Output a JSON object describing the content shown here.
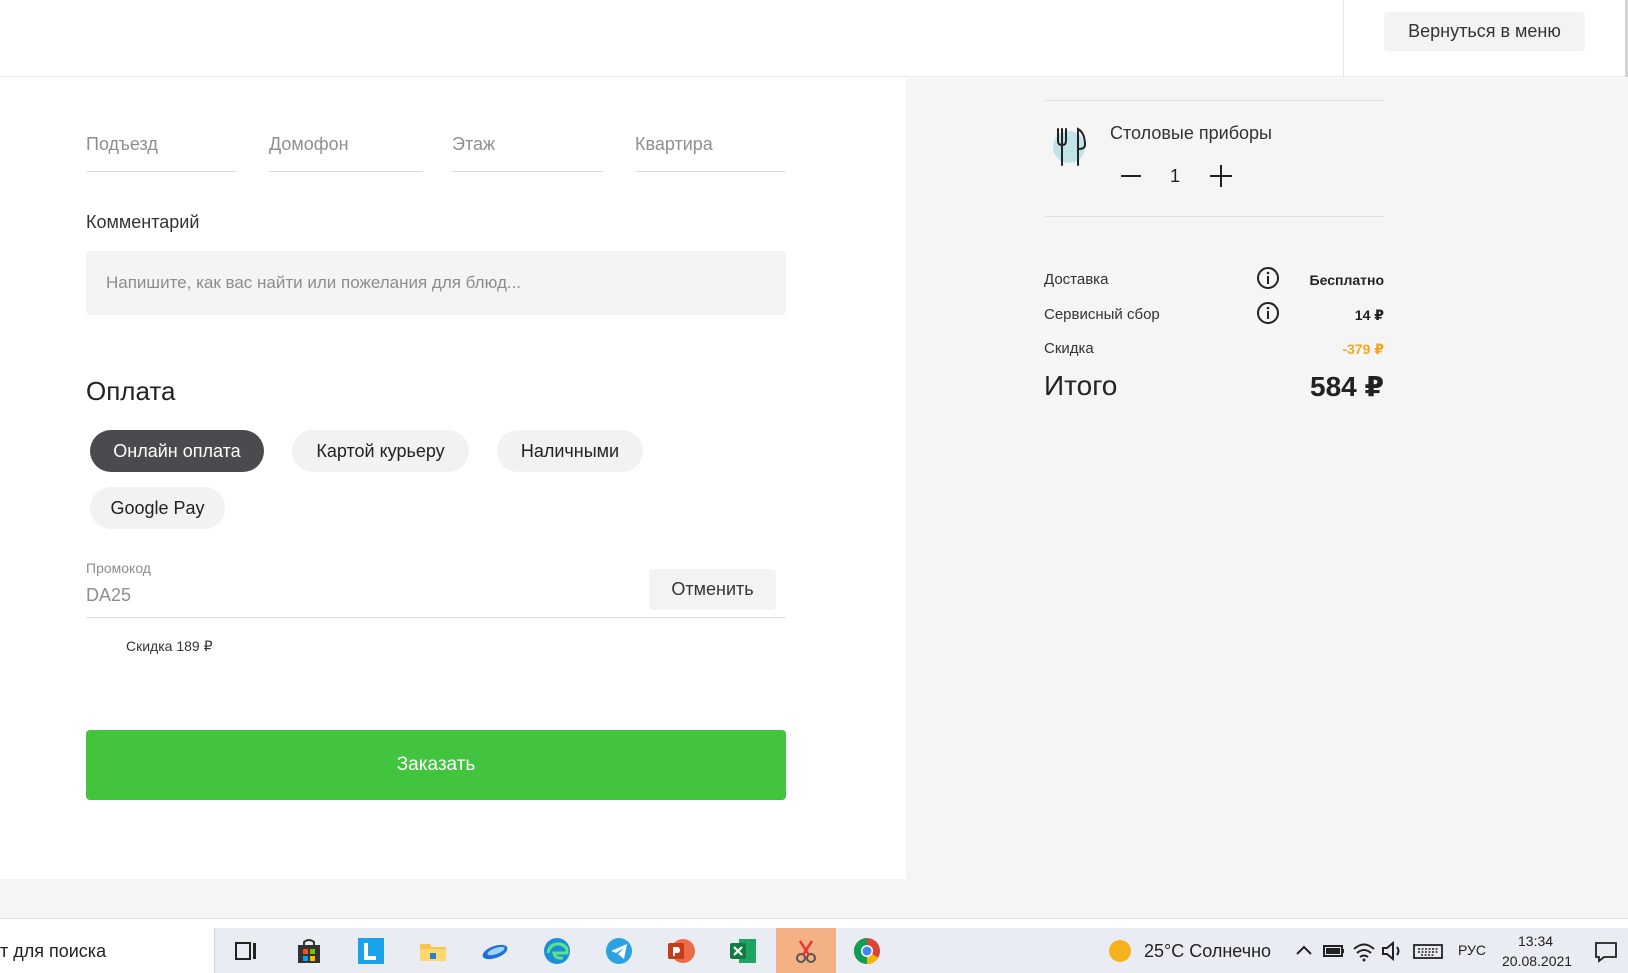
{
  "header": {
    "back_label": "Вернуться в меню"
  },
  "address": {
    "entrance_placeholder": "Подъезд",
    "intercom_placeholder": "Домофон",
    "floor_placeholder": "Этаж",
    "apartment_placeholder": "Квартира"
  },
  "comment": {
    "label": "Комментарий",
    "placeholder": "Напишите, как вас найти или пожелания для блюд..."
  },
  "payment": {
    "title": "Оплата",
    "options": [
      {
        "label": "Онлайн оплата",
        "selected": true
      },
      {
        "label": "Картой курьеру",
        "selected": false
      },
      {
        "label": "Наличными",
        "selected": false
      },
      {
        "label": "Google Pay",
        "selected": false
      }
    ]
  },
  "promo": {
    "label": "Промокод",
    "value": "DA25",
    "cancel_label": "Отменить",
    "note": "Скидка 189 ₽"
  },
  "order": {
    "label": "Заказать"
  },
  "cutlery": {
    "title": "Столовые приборы",
    "count": "1",
    "icon": "cutlery-icon"
  },
  "summary": {
    "delivery_label": "Доставка",
    "delivery_value": "Бесплатно",
    "service_label": "Сервисный сбор",
    "service_value": "14 ₽",
    "discount_label": "Скидка",
    "discount_value": "-379 ₽",
    "total_label": "Итого",
    "total_value": "584 ₽"
  },
  "colors": {
    "accent_green": "#42c43f",
    "discount_orange": "#f5a623",
    "chip_active": "#4b4b4f"
  },
  "taskbar": {
    "search_text": "т для поиска",
    "weather": "25°C  Солнечно",
    "lang": "РУС",
    "time": "13:34",
    "date": "20.08.2021"
  }
}
